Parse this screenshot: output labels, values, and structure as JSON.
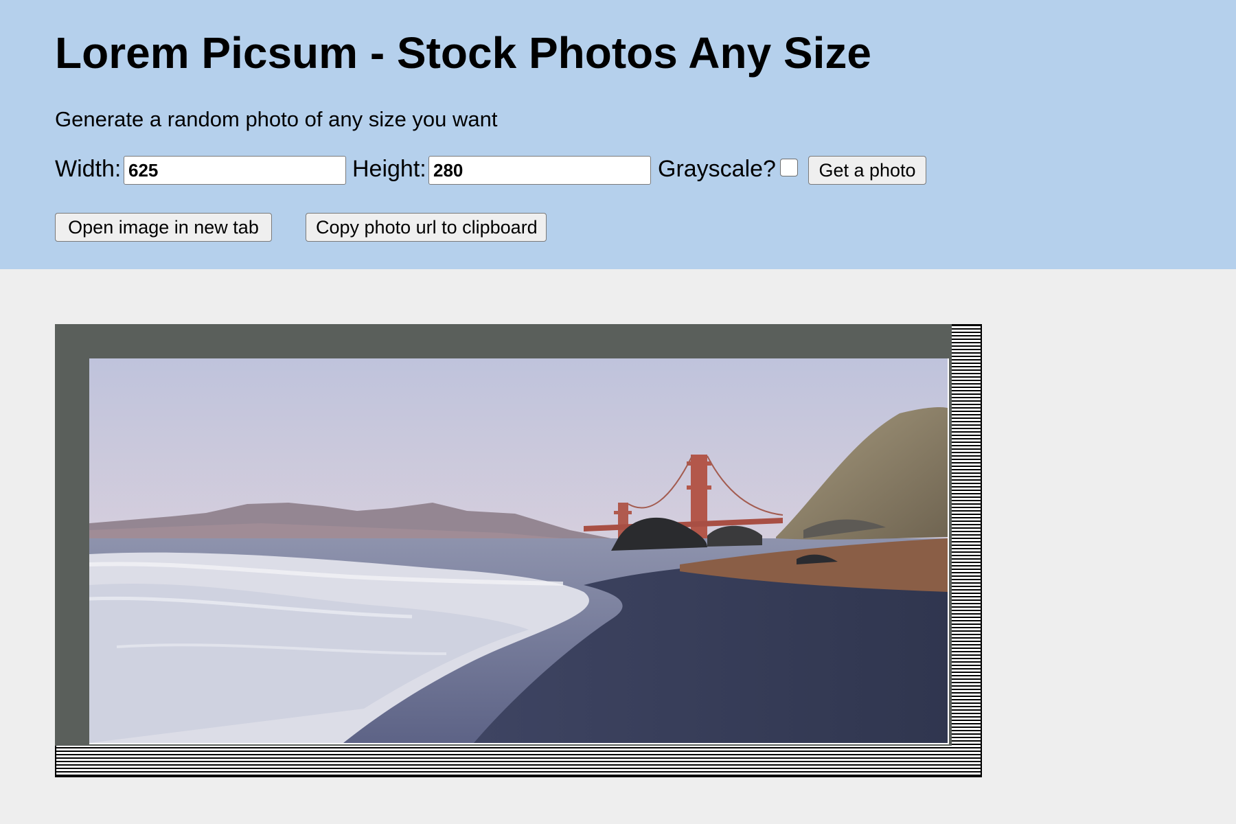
{
  "header": {
    "title": "Lorem Picsum - Stock Photos Any Size",
    "subtitle": "Generate a random photo of any size you want"
  },
  "form": {
    "width_label": "Width:",
    "width_value": "625",
    "height_label": "Height:",
    "height_value": "280",
    "grayscale_label": "Grayscale?",
    "grayscale_checked": false,
    "get_photo_label": "Get a photo"
  },
  "actions": {
    "open_new_tab_label": "Open image in new tab",
    "copy_url_label": "Copy photo url to clipboard"
  },
  "colors": {
    "header_bg": "#b5d0ec",
    "page_bg": "#eeeeee",
    "matte": "#5a5f5b"
  }
}
